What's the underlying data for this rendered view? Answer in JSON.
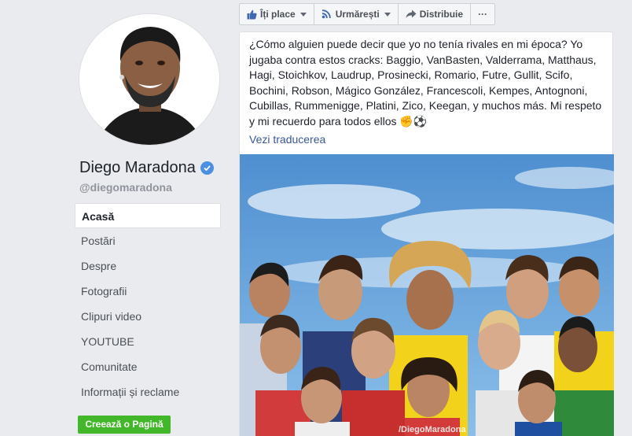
{
  "page": {
    "name": "Diego Maradona",
    "handle": "@diegomaradona"
  },
  "nav": {
    "items": [
      {
        "label": "Acasă",
        "active": true
      },
      {
        "label": "Postări"
      },
      {
        "label": "Despre"
      },
      {
        "label": "Fotografii"
      },
      {
        "label": "Clipuri video"
      },
      {
        "label": "YOUTUBE"
      },
      {
        "label": "Comunitate"
      },
      {
        "label": "Informații și reclame"
      }
    ],
    "create_page_label": "Creează o Pagină"
  },
  "actions": {
    "like_label": "Îți place",
    "follow_label": "Urmărești",
    "share_label": "Distribuie",
    "more_label": "···"
  },
  "post": {
    "text": "¿Cómo alguien puede decir que yo no tenía rivales en mi época? Yo jugaba contra estos cracks: Baggio, VanBasten, Valderrama, Matthaus, Hagi, Stoichkov, Laudrup, Prosinecki, Romario, Futre, Gullit, Scifo, Bochini, Robson, Mágico González, Francescoli, Kempes, Antognoni, Cubillas, Rummenigge, Platini, Zico, Keegan, y muchos más. Mi respeto y mi recuerdo para todos ellos ✊⚽",
    "translate_label": "Vezi traducerea",
    "image_watermark": "/DiegoMaradona"
  },
  "colors": {
    "background": "#e9ebee",
    "link": "#385898",
    "create_button": "#42b72a",
    "verified": "#4a90e2",
    "sky": "#5a9ad3"
  }
}
